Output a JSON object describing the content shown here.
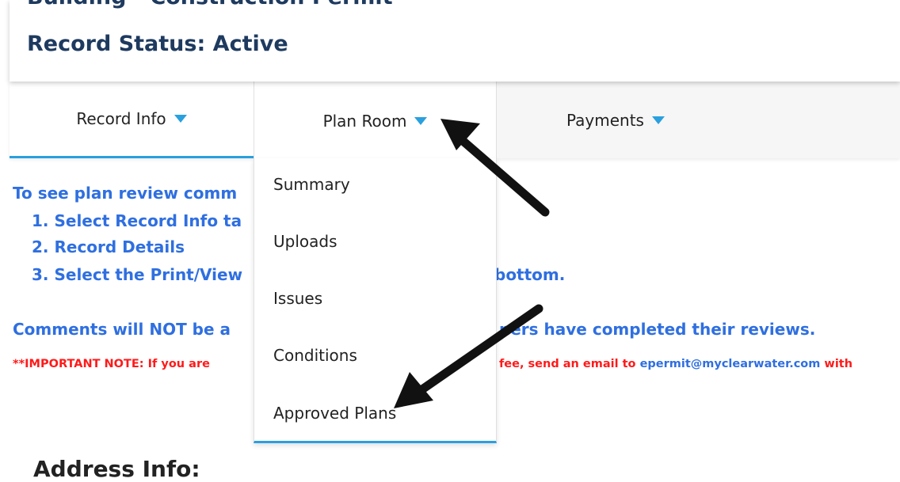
{
  "header": {
    "record_type": "Building - Construction Permit",
    "record_status": "Record Status: Active"
  },
  "tabs": {
    "record_info": "Record Info",
    "plan_room": "Plan Room",
    "payments": "Payments"
  },
  "dropdown": {
    "items": [
      "Summary",
      "Uploads",
      "Issues",
      "Conditions",
      "Approved Plans"
    ]
  },
  "content": {
    "intro": "To see plan review comm",
    "step1": "1. Select Record Info ta",
    "step2": "2. Record Details",
    "step3_start": "3. Select the Print/View",
    "step3_end": "bottom.",
    "comments_start": "Comments will NOT be a",
    "comments_end": "ners have completed their reviews.",
    "important_start": "**IMPORTANT NOTE:  If you are",
    "important_mid": "fee, send an email to ",
    "important_email": "epermit@myclearwater.com",
    "important_end": " with",
    "address_heading": "Address Info:"
  },
  "colors": {
    "accent": "#2aa0de",
    "title": "#1e3a5f",
    "link_text": "#2f6fe0",
    "important": "#ff1a1a"
  }
}
